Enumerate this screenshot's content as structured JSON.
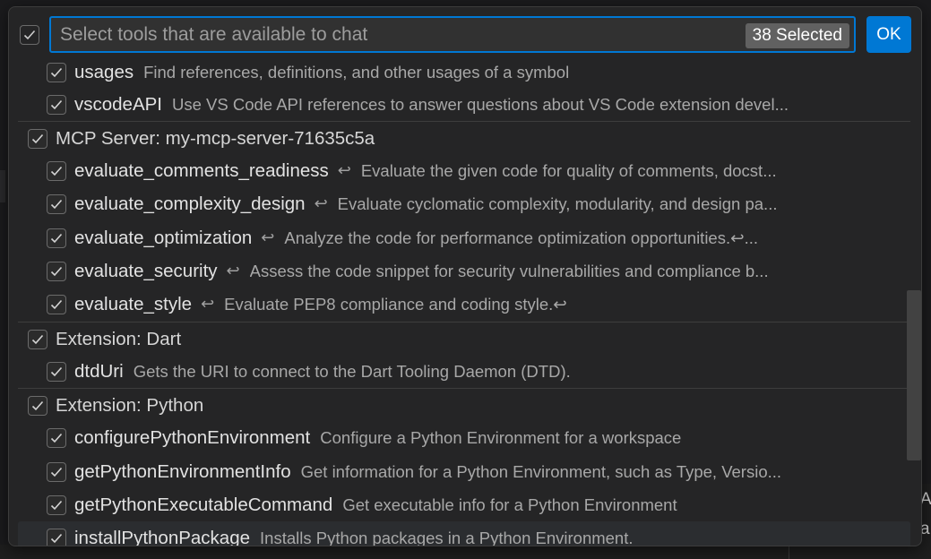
{
  "background": {
    "right_text_lines": [
      "A",
      "a"
    ]
  },
  "header": {
    "search_placeholder": "Select tools that are available to chat",
    "selected_count": "38 Selected",
    "ok_label": "OK"
  },
  "tools": [
    {
      "kind": "item",
      "name": "usages",
      "enter": false,
      "desc": "Find references, definitions, and other usages of a symbol",
      "checked": true
    },
    {
      "kind": "item",
      "name": "vscodeAPI",
      "enter": false,
      "desc": "Use VS Code API references to answer questions about VS Code extension devel...",
      "checked": true
    },
    {
      "kind": "group",
      "name": "MCP Server: my-mcp-server-71635c5a",
      "checked": true
    },
    {
      "kind": "item",
      "name": "evaluate_comments_readiness",
      "enter": true,
      "desc": "Evaluate the given code for quality of comments, docst...",
      "checked": true
    },
    {
      "kind": "item",
      "name": "evaluate_complexity_design",
      "enter": true,
      "desc": "Evaluate cyclomatic complexity, modularity, and design pa...",
      "checked": true
    },
    {
      "kind": "item",
      "name": "evaluate_optimization",
      "enter": true,
      "desc": "Analyze the code for performance optimization opportunities.↩...",
      "checked": true
    },
    {
      "kind": "item",
      "name": "evaluate_security",
      "enter": true,
      "desc": "Assess the code snippet for security vulnerabilities and compliance b...",
      "checked": true
    },
    {
      "kind": "item",
      "name": "evaluate_style",
      "enter": true,
      "desc": "Evaluate PEP8 compliance and coding style.↩",
      "checked": true
    },
    {
      "kind": "group",
      "name": "Extension: Dart",
      "checked": true
    },
    {
      "kind": "item",
      "name": "dtdUri",
      "enter": false,
      "desc": "Gets the URI to connect to the Dart Tooling Daemon (DTD).",
      "checked": true
    },
    {
      "kind": "group",
      "name": "Extension: Python",
      "checked": true
    },
    {
      "kind": "item",
      "name": "configurePythonEnvironment",
      "enter": false,
      "desc": "Configure a Python Environment for a workspace",
      "checked": true
    },
    {
      "kind": "item",
      "name": "getPythonEnvironmentInfo",
      "enter": false,
      "desc": "Get information for a Python Environment, such as Type, Versio...",
      "checked": true
    },
    {
      "kind": "item",
      "name": "getPythonExecutableCommand",
      "enter": false,
      "desc": "Get executable info for a Python Environment",
      "checked": true
    },
    {
      "kind": "item",
      "name": "installPythonPackage",
      "enter": false,
      "desc": "Installs Python packages in a Python Environment.",
      "checked": true
    }
  ],
  "colors": {
    "accent": "#0078d4",
    "panel": "#252526",
    "badge": "#616161"
  }
}
